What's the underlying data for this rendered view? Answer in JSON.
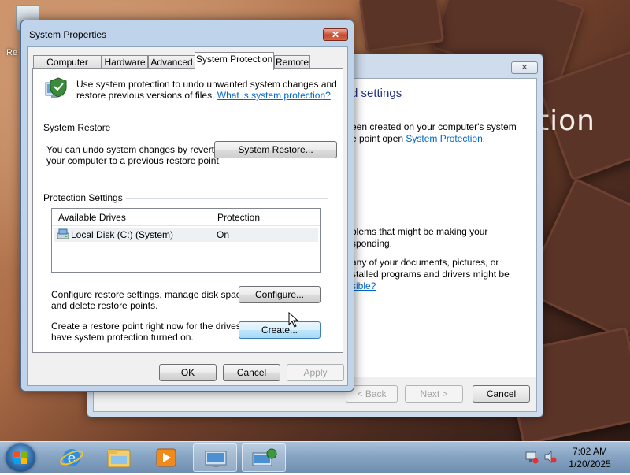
{
  "desktop": {
    "icons": [
      {
        "name": "recycle-bin",
        "label": "Re"
      }
    ],
    "wallpaper_text": "ition"
  },
  "wizard": {
    "close_glyph": "✕",
    "heading": "d settings",
    "para1_line1": "een created on your computer's system",
    "para1_line2_prefix": "e point open ",
    "para1_link": "System Protection",
    "para1_line2_suffix": ".",
    "para2_line1": "blems that might be making your",
    "para2_line2": "sponding.",
    "para3_line1": "any of your documents, pictures, or",
    "para3_line2": "stalled programs and drivers might be",
    "para3_link": "sible?",
    "buttons": {
      "back": "< Back",
      "next": "Next >",
      "cancel": "Cancel"
    }
  },
  "sysprops": {
    "title": "System Properties",
    "close_glyph": "✕",
    "tabs": [
      {
        "label": "Computer Name",
        "active": false
      },
      {
        "label": "Hardware",
        "active": false
      },
      {
        "label": "Advanced",
        "active": false
      },
      {
        "label": "System Protection",
        "active": true
      },
      {
        "label": "Remote",
        "active": false
      }
    ],
    "intro_line1": "Use system protection to undo unwanted system changes and",
    "intro_line2": "restore previous versions of files.",
    "intro_link": "What is system protection?",
    "system_restore": {
      "heading": "System Restore",
      "desc_line1": "You can undo system changes by reverting",
      "desc_line2": "your computer to a previous restore point.",
      "button": "System Restore..."
    },
    "protection_settings": {
      "heading": "Protection Settings",
      "columns": [
        "Available Drives",
        "Protection"
      ],
      "rows": [
        {
          "drive": "Local Disk (C:) (System)",
          "protection": "On"
        }
      ],
      "configure_line1": "Configure restore settings, manage disk space,",
      "configure_line2": "and delete restore points.",
      "configure_button": "Configure...",
      "create_line1": "Create a restore point right now for the drives that",
      "create_line2": "have system protection turned on.",
      "create_button": "Create..."
    },
    "footer": {
      "ok": "OK",
      "cancel": "Cancel",
      "apply": "Apply"
    }
  },
  "taskbar": {
    "items": [
      "start-orb",
      "internet-explorer",
      "windows-explorer",
      "media-player",
      "system-properties",
      "system-restore"
    ],
    "time": "7:02 AM",
    "date": "1/20/2025"
  },
  "colors": {
    "link": "#0066cc",
    "heading_blue": "#1e3287",
    "close_red": "#c34a2f"
  }
}
